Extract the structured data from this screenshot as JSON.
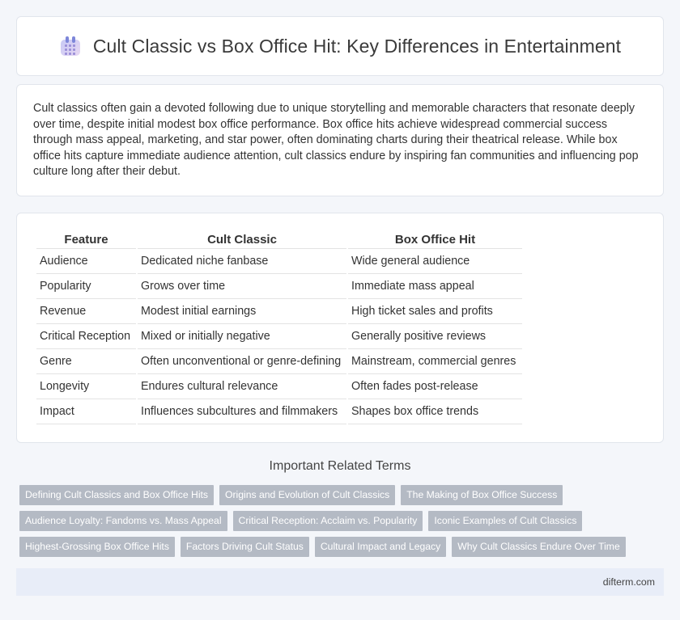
{
  "header": {
    "title": "Cult Classic vs Box Office Hit: Key Differences in Entertainment",
    "icon": "calendar-icon"
  },
  "intro": {
    "text": "Cult classics often gain a devoted following due to unique storytelling and memorable characters that resonate deeply over time, despite initial modest box office performance. Box office hits achieve widespread commercial success through mass appeal, marketing, and star power, often dominating charts during their theatrical release. While box office hits capture immediate audience attention, cult classics endure by inspiring fan communities and influencing pop culture long after their debut."
  },
  "table": {
    "headers": [
      "Feature",
      "Cult Classic",
      "Box Office Hit"
    ],
    "rows": [
      [
        "Audience",
        "Dedicated niche fanbase",
        "Wide general audience"
      ],
      [
        "Popularity",
        "Grows over time",
        "Immediate mass appeal"
      ],
      [
        "Revenue",
        "Modest initial earnings",
        "High ticket sales and profits"
      ],
      [
        "Critical Reception",
        "Mixed or initially negative",
        "Generally positive reviews"
      ],
      [
        "Genre",
        "Often unconventional or genre-defining",
        "Mainstream, commercial genres"
      ],
      [
        "Longevity",
        "Endures cultural relevance",
        "Often fades post-release"
      ],
      [
        "Impact",
        "Influences subcultures and filmmakers",
        "Shapes box office trends"
      ]
    ]
  },
  "related": {
    "title": "Important Related Terms",
    "tag_rows": [
      [
        "Defining Cult Classics and Box Office Hits",
        "Origins and Evolution of Cult Classics",
        "The Making of Box Office Success"
      ],
      [
        "Audience Loyalty: Fandoms vs. Mass Appeal",
        "Critical Reception: Acclaim vs. Popularity",
        "Iconic Examples of Cult Classics"
      ],
      [
        "Highest-Grossing Box Office Hits",
        "Factors Driving Cult Status",
        "Cultural Impact and Legacy",
        "Why Cult Classics Endure Over Time"
      ]
    ]
  },
  "footer": {
    "site": "difterm.com"
  },
  "colors": {
    "background": "#f4f6fa",
    "tag_background": "#b4bac4",
    "footer_background": "#e8edf8"
  }
}
